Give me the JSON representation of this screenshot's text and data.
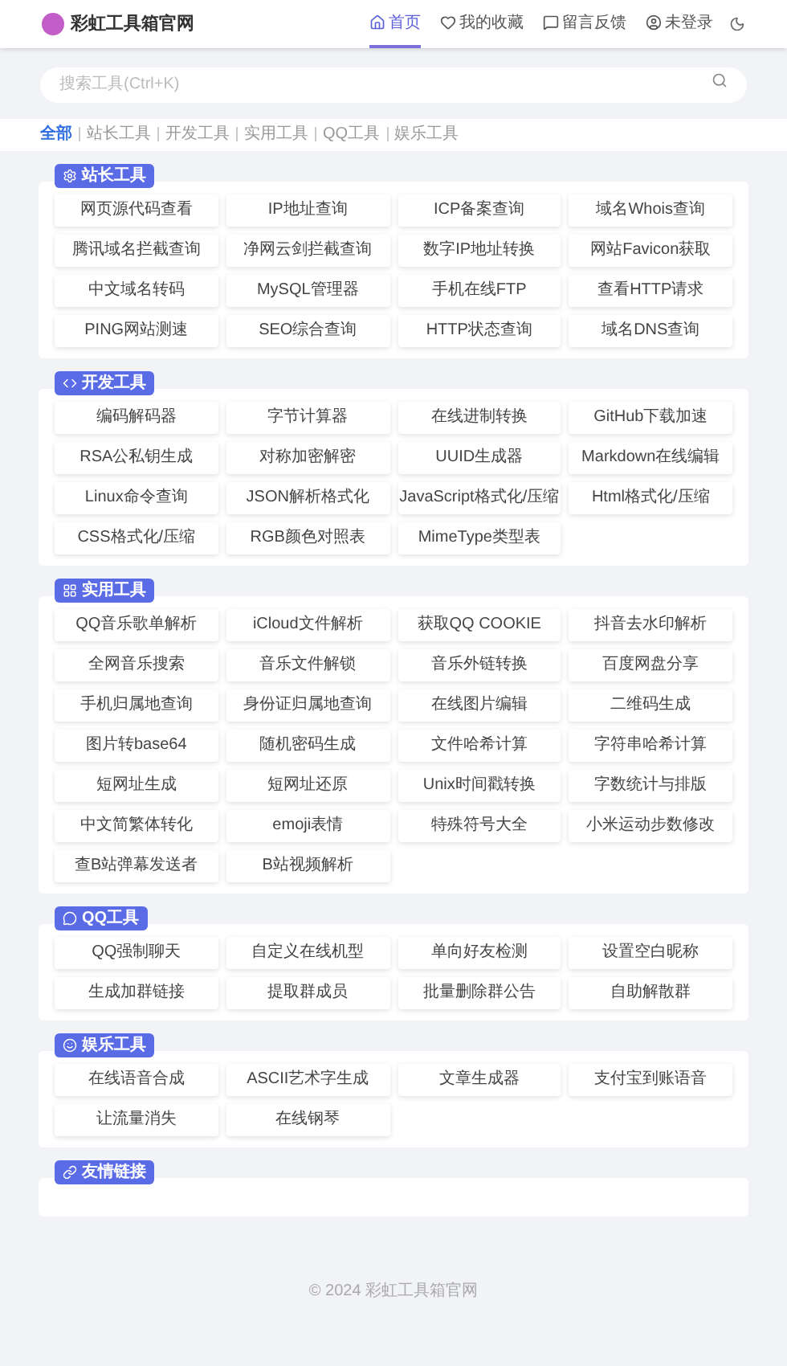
{
  "header": {
    "logo": "彩虹工具箱官网",
    "nav": [
      {
        "label": "首页",
        "selected": true
      },
      {
        "label": "我的收藏",
        "selected": false
      },
      {
        "label": "留言反馈",
        "selected": false
      },
      {
        "label": "未登录",
        "selected": false
      }
    ]
  },
  "search": {
    "placeholder": "搜索工具(Ctrl+K)"
  },
  "filters": [
    {
      "label": "全部",
      "selected": true
    },
    {
      "label": "站长工具",
      "selected": false
    },
    {
      "label": "开发工具",
      "selected": false
    },
    {
      "label": "实用工具",
      "selected": false
    },
    {
      "label": "QQ工具",
      "selected": false
    },
    {
      "label": "娱乐工具",
      "selected": false
    }
  ],
  "sections": [
    {
      "title": "站长工具",
      "tools": [
        "网页源代码查看",
        "IP地址查询",
        "ICP备案查询",
        "域名Whois查询",
        "腾讯域名拦截查询",
        "净网云剑拦截查询",
        "数字IP地址转换",
        "网站Favicon获取",
        "中文域名转码",
        "MySQL管理器",
        "手机在线FTP",
        "查看HTTP请求",
        "PING网站测速",
        "SEO综合查询",
        "HTTP状态查询",
        "域名DNS查询"
      ]
    },
    {
      "title": "开发工具",
      "tools": [
        "编码解码器",
        "字节计算器",
        "在线进制转换",
        "GitHub下载加速",
        "RSA公私钥生成",
        "对称加密解密",
        "UUID生成器",
        "Markdown在线编辑",
        "Linux命令查询",
        "JSON解析格式化",
        "JavaScript格式化/压缩",
        "Html格式化/压缩",
        "CSS格式化/压缩",
        "RGB颜色对照表",
        "MimeType类型表"
      ]
    },
    {
      "title": "实用工具",
      "tools": [
        "QQ音乐歌单解析",
        "iCloud文件解析",
        "获取QQ COOKIE",
        "抖音去水印解析",
        "全网音乐搜索",
        "音乐文件解锁",
        "音乐外链转换",
        "百度网盘分享",
        "手机归属地查询",
        "身份证归属地查询",
        "在线图片编辑",
        "二维码生成",
        "图片转base64",
        "随机密码生成",
        "文件哈希计算",
        "字符串哈希计算",
        "短网址生成",
        "短网址还原",
        "Unix时间戳转换",
        "字数统计与排版",
        "中文简繁体转化",
        "emoji表情",
        "特殊符号大全",
        "小米运动步数修改",
        "查B站弹幕发送者",
        "B站视频解析"
      ]
    },
    {
      "title": "QQ工具",
      "tools": [
        "QQ强制聊天",
        "自定义在线机型",
        "单向好友检测",
        "设置空白昵称",
        "生成加群链接",
        "提取群成员",
        "批量删除群公告",
        "自助解散群"
      ]
    },
    {
      "title": "娱乐工具",
      "tools": [
        "在线语音合成",
        "ASCII艺术字生成",
        "文章生成器",
        "支付宝到账语音",
        "让流量消失",
        "在线钢琴"
      ]
    },
    {
      "title": "友情链接"
    }
  ],
  "footer": "© 2024 彩虹工具箱官网"
}
